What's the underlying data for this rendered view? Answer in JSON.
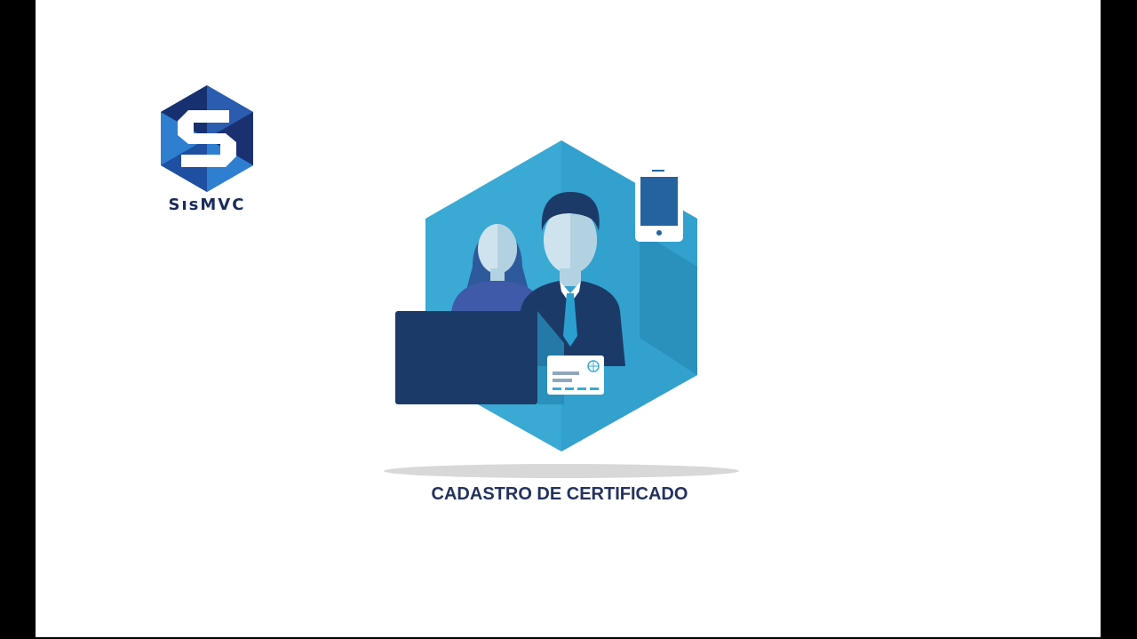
{
  "logo": {
    "text": "SısMVC",
    "icon": "hexagon-s-logo-icon"
  },
  "illustration": {
    "icons": [
      "user-woman-icon",
      "user-man-icon",
      "smartphone-icon",
      "laptop-icon",
      "id-card-icon"
    ]
  },
  "caption": "CADASTRO DE CERTIFICADO",
  "colors": {
    "hex_light": "#3aa9d4",
    "hex_dark": "#2789b5",
    "navy": "#1c3a68",
    "logo_dark": "#1e3a8a",
    "logo_light": "#2f7fd0",
    "caption": "#23325e"
  }
}
